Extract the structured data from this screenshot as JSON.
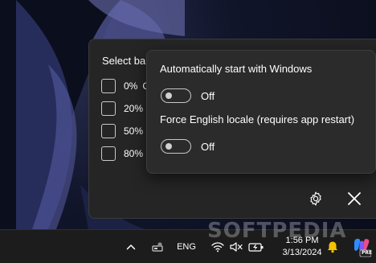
{
  "window": {
    "title_partial": "Select ba",
    "options": [
      {
        "label": "0%",
        "trailing": "C"
      },
      {
        "label": "20%"
      },
      {
        "label": "50%"
      },
      {
        "label": "80%"
      }
    ]
  },
  "settings": {
    "autostart": {
      "title": "Automatically start with Windows",
      "state": "Off"
    },
    "force_english": {
      "title": "Force English locale (requires app restart)",
      "state": "Off"
    }
  },
  "taskbar": {
    "language": "ENG",
    "time": "1:56 PM",
    "date": "3/13/2024",
    "copilot_badge": "PRE"
  },
  "watermark": "SOFTPEDIA",
  "icons": {
    "settings": "gear-icon",
    "close": "close-icon",
    "chevron": "chevron-up-icon",
    "wifi": "wifi-icon",
    "volume": "volume-muted-icon",
    "battery": "battery-icon",
    "bell": "bell-icon",
    "copilot": "copilot-icon"
  },
  "colors": {
    "panel_bg": "#252526",
    "popup_bg": "#2b2b2b",
    "taskbar_bg": "#1c1c1c",
    "bell": "#f3c300"
  }
}
